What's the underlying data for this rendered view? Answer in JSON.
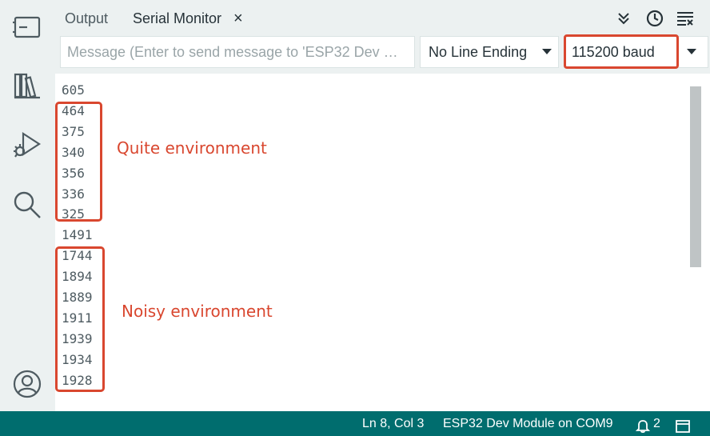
{
  "tabs": {
    "output_label": "Output",
    "serial_label": "Serial Monitor",
    "close_glyph": "×"
  },
  "toolbar": {
    "message_placeholder": "Message (Enter to send message to 'ESP32 Dev …",
    "line_ending": "No Line Ending",
    "baud": "115200 baud"
  },
  "icons": {
    "header": [
      "double-chevron-down-icon",
      "clock-icon",
      "clear-output-icon"
    ],
    "activity": [
      "board-icon",
      "library-icon",
      "debug-icon",
      "search-icon",
      "account-icon"
    ]
  },
  "output_lines": [
    "605",
    "464",
    "375",
    "340",
    "356",
    "336",
    "325",
    "1491",
    "1744",
    "1894",
    "1889",
    "1911",
    "1939",
    "1934",
    "1928"
  ],
  "annotations": {
    "quiet": "Quite environment",
    "noisy": "Noisy environment"
  },
  "status": {
    "position": "Ln 8, Col 3",
    "board": "ESP32 Dev Module on COM9",
    "notifications": "2"
  },
  "colors": {
    "status_bar": "#006d6e",
    "highlight": "#d9472f",
    "sidebar": "#ecf1f1"
  }
}
